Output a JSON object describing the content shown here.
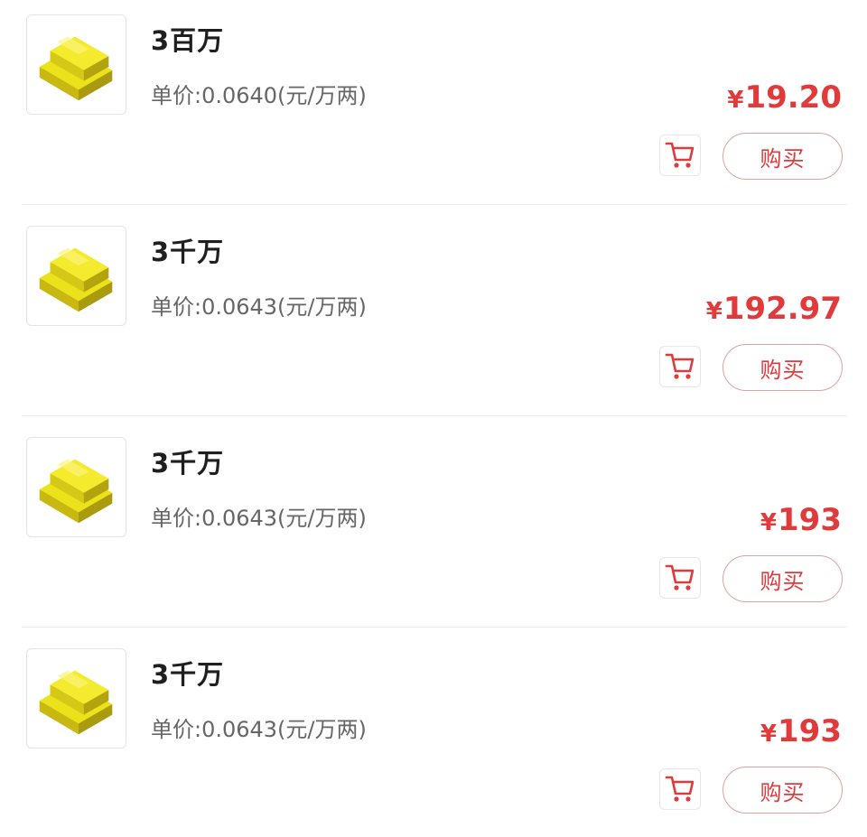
{
  "items": [
    {
      "title": "3百万",
      "unit_price": "单价:0.0640(元/万两)",
      "price_symbol": "¥",
      "price_value": "19.20",
      "buy_label": "购买",
      "image_icon": "gold-bars-icon"
    },
    {
      "title": "3千万",
      "unit_price": "单价:0.0643(元/万两)",
      "price_symbol": "¥",
      "price_value": "192.97",
      "buy_label": "购买",
      "image_icon": "gold-bars-icon"
    },
    {
      "title": "3千万",
      "unit_price": "单价:0.0643(元/万两)",
      "price_symbol": "¥",
      "price_value": "193",
      "buy_label": "购买",
      "image_icon": "gold-bars-icon"
    },
    {
      "title": "3千万",
      "unit_price": "单价:0.0643(元/万两)",
      "price_symbol": "¥",
      "price_value": "193",
      "buy_label": "购买",
      "image_icon": "gold-bars-icon"
    }
  ],
  "colors": {
    "accent": "#e03a3a",
    "title": "#1f1f1f",
    "secondary_text": "#666666",
    "divider": "#ececec",
    "gold": "#f0e020"
  }
}
